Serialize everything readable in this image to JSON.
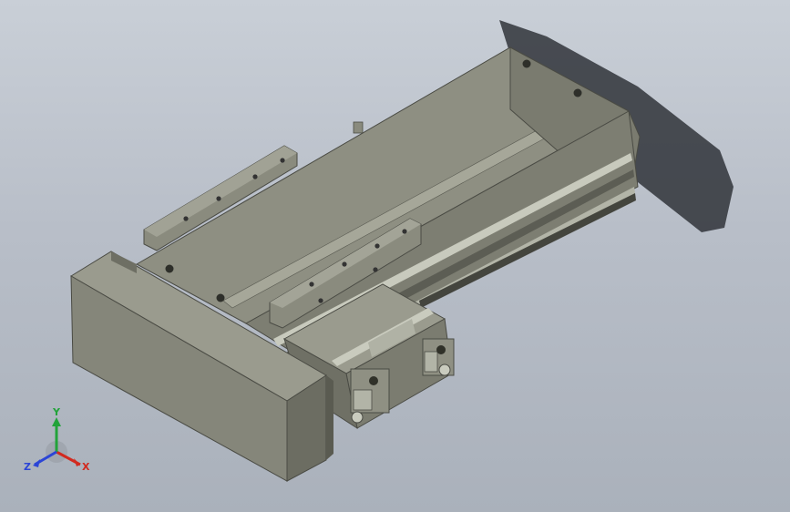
{
  "viewport": {
    "background_top": "#c9cfd7",
    "background_bottom": "#aab1bb"
  },
  "model": {
    "body_color": "#8c8d80",
    "body_dark": "#6a6b60",
    "body_light": "#a4a597",
    "shadow_color": "#2f3338"
  },
  "triad": {
    "x_label": "X",
    "y_label": "Y",
    "z_label": "Z",
    "x_color": "#d22a1f",
    "y_color": "#22a33a",
    "z_color": "#2b45d6"
  }
}
